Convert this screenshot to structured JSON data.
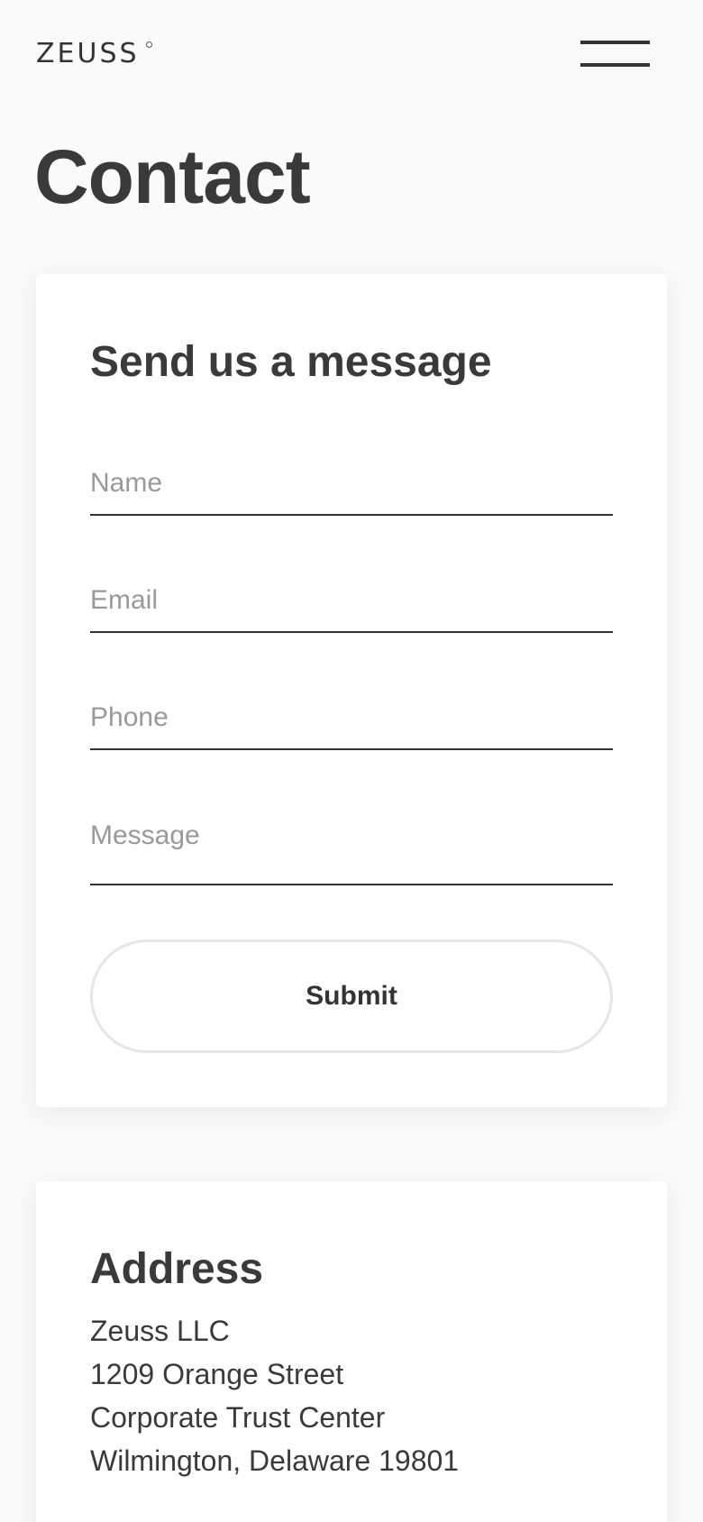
{
  "header": {
    "logo_text": "ZEUSS",
    "menu_icon": "hamburger-menu-icon"
  },
  "page": {
    "title": "Contact"
  },
  "form": {
    "title": "Send us a message",
    "fields": {
      "name": {
        "placeholder": "Name",
        "value": ""
      },
      "email": {
        "placeholder": "Email",
        "value": ""
      },
      "phone": {
        "placeholder": "Phone",
        "value": ""
      },
      "message": {
        "placeholder": "Message",
        "value": ""
      }
    },
    "submit_label": "Submit"
  },
  "address": {
    "title": "Address",
    "lines": [
      "Zeuss LLC",
      "1209 Orange Street",
      "Corporate Trust Center",
      "Wilmington, Delaware 19801"
    ]
  },
  "colors": {
    "text": "#3a3a3a",
    "background": "#fafafa",
    "card": "#ffffff",
    "placeholder": "#999999",
    "button_border": "#e6e6e6"
  }
}
